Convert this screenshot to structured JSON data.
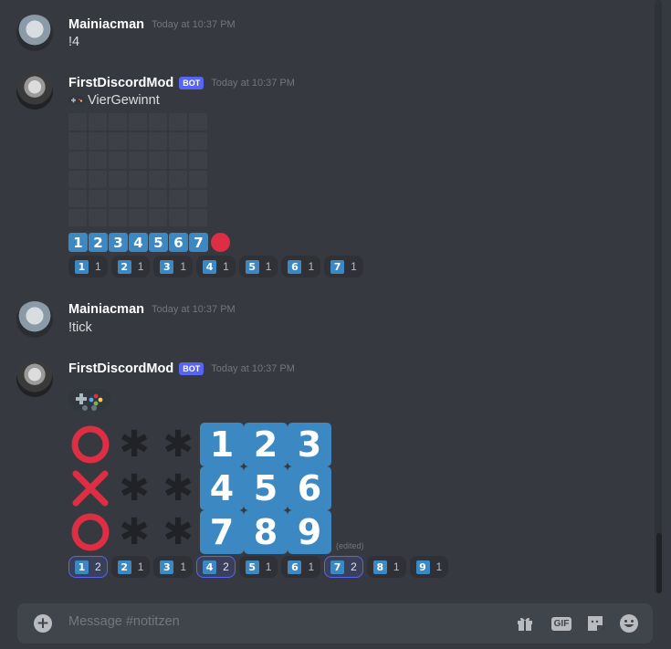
{
  "messages": [
    {
      "author": "Mainiacman",
      "timestamp": "Today at 10:37 PM",
      "text": "!4"
    },
    {
      "author": "FirstDiscordMod",
      "bot_tag": "BOT",
      "timestamp": "Today at 10:37 PM",
      "text": "VierGewinnt",
      "number_row": [
        "1",
        "2",
        "3",
        "4",
        "5",
        "6",
        "7"
      ],
      "reactions": [
        {
          "key": "1",
          "count": "1"
        },
        {
          "key": "2",
          "count": "1"
        },
        {
          "key": "3",
          "count": "1"
        },
        {
          "key": "4",
          "count": "1"
        },
        {
          "key": "5",
          "count": "1"
        },
        {
          "key": "6",
          "count": "1"
        },
        {
          "key": "7",
          "count": "1"
        }
      ]
    },
    {
      "author": "Mainiacman",
      "timestamp": "Today at 10:37 PM",
      "text": "!tick"
    },
    {
      "author": "FirstDiscordMod",
      "bot_tag": "BOT",
      "timestamp": "Today at 10:37 PM",
      "edited": "(edited)",
      "keypad": [
        "1",
        "2",
        "3",
        "4",
        "5",
        "6",
        "7",
        "8",
        "9"
      ],
      "reactions": [
        {
          "key": "1",
          "count": "2"
        },
        {
          "key": "2",
          "count": "1"
        },
        {
          "key": "3",
          "count": "1"
        },
        {
          "key": "4",
          "count": "2"
        },
        {
          "key": "5",
          "count": "1"
        },
        {
          "key": "6",
          "count": "1"
        },
        {
          "key": "7",
          "count": "2"
        },
        {
          "key": "8",
          "count": "1"
        },
        {
          "key": "9",
          "count": "1"
        }
      ]
    }
  ],
  "composer": {
    "placeholder": "Message #notitzen",
    "gif_label": "GIF"
  },
  "colors": {
    "background": "#36393f",
    "accent": "#5865f2",
    "keycap": "#3b88c3",
    "red": "#dd2e44"
  },
  "icons": [
    "add-circle-icon",
    "gift-icon",
    "gif-icon",
    "sticker-icon",
    "emoji-icon",
    "gamepad-icon",
    "red-circle-icon"
  ]
}
